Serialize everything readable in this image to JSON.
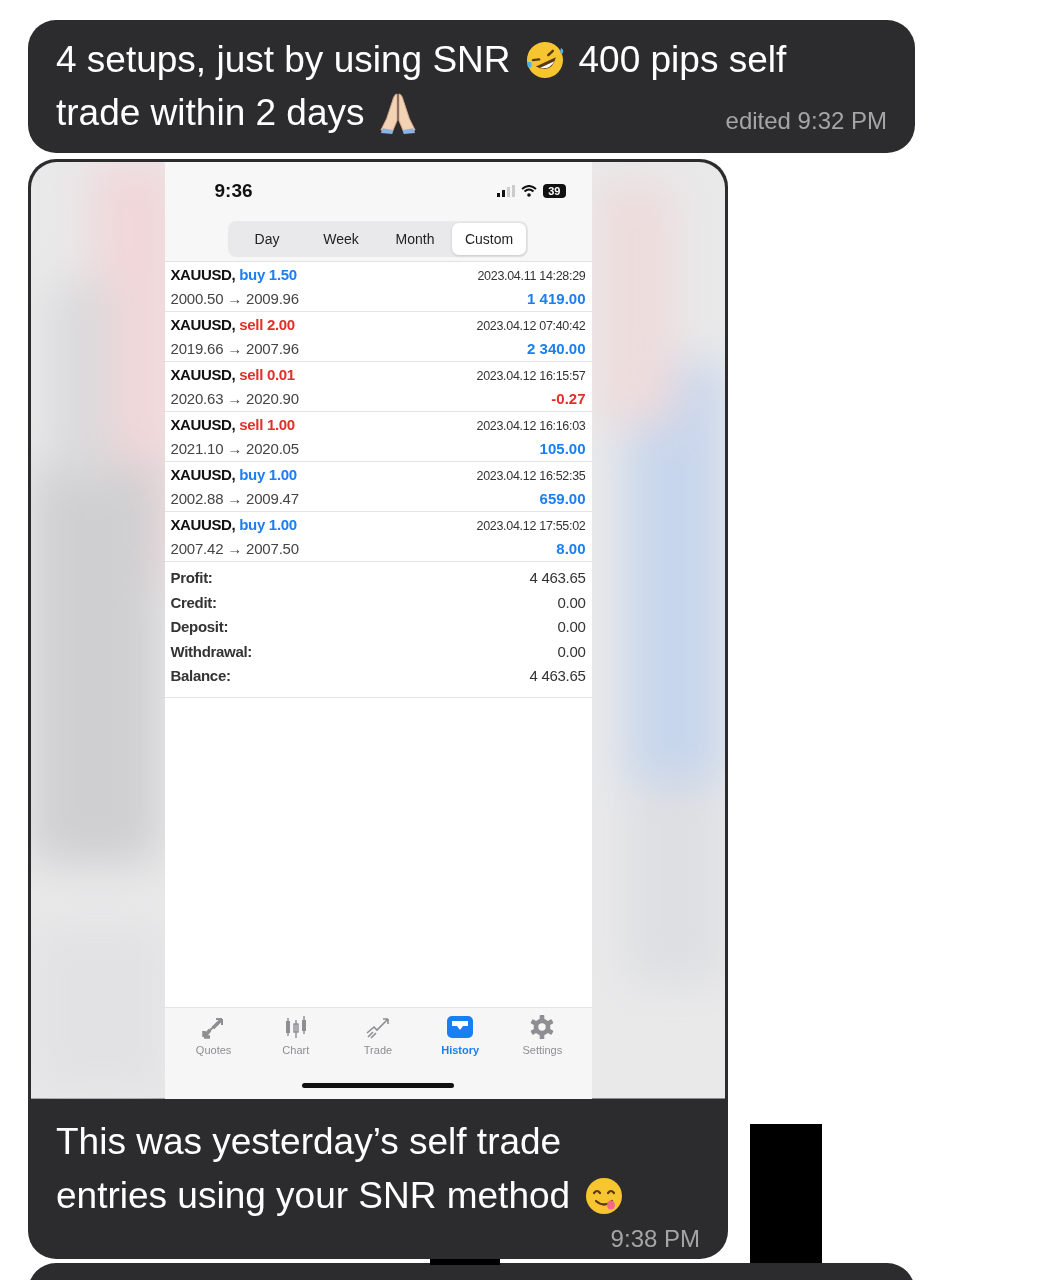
{
  "messages": [
    {
      "kind": "text",
      "lines": [
        [
          {
            "kind": "text",
            "text": "4 setups, just by using SNR"
          },
          {
            "kind": "laughing-emoji"
          },
          {
            "kind": "text",
            "text": "400 pips self"
          }
        ],
        [
          {
            "kind": "text",
            "text": "trade within 2 days"
          },
          {
            "kind": "praying-emoji"
          }
        ]
      ],
      "time": "edited 9:32 PM"
    },
    {
      "kind": "screenshot",
      "caption_lines": [
        [
          {
            "kind": "text",
            "text": "This was yesterday’s self trade"
          }
        ],
        [
          {
            "kind": "text",
            "text": "entries using your SNR method"
          },
          {
            "kind": "yum-emoji"
          }
        ]
      ],
      "time": "9:38 PM",
      "phone": {
        "status_time": "9:36",
        "battery": "39",
        "tabs": [
          {
            "label": "Day",
            "selected": false
          },
          {
            "label": "Week",
            "selected": false
          },
          {
            "label": "Month",
            "selected": false
          },
          {
            "label": "Custom",
            "selected": true
          }
        ],
        "trades": [
          {
            "symbol": "XAUUSD,",
            "kind": "buy",
            "order": "buy 1.50",
            "time": "2023.04.11 14:28:29",
            "prices": "2000.50 → 2009.96",
            "profit": "1 419.00",
            "negative": false
          },
          {
            "symbol": "XAUUSD,",
            "kind": "sell",
            "order": "sell 2.00",
            "time": "2023.04.12 07:40:42",
            "prices": "2019.66 → 2007.96",
            "profit": "2 340.00",
            "negative": false
          },
          {
            "symbol": "XAUUSD,",
            "kind": "sell",
            "order": "sell 0.01",
            "time": "2023.04.12 16:15:57",
            "prices": "2020.63 → 2020.90",
            "profit": "-0.27",
            "negative": true
          },
          {
            "symbol": "XAUUSD,",
            "kind": "sell",
            "order": "sell 1.00",
            "time": "2023.04.12 16:16:03",
            "prices": "2021.10 → 2020.05",
            "profit": "105.00",
            "negative": false
          },
          {
            "symbol": "XAUUSD,",
            "kind": "buy",
            "order": "buy 1.00",
            "time": "2023.04.12 16:52:35",
            "prices": "2002.88 → 2009.47",
            "profit": "659.00",
            "negative": false
          },
          {
            "symbol": "XAUUSD,",
            "kind": "buy",
            "order": "buy 1.00",
            "time": "2023.04.12 17:55:02",
            "prices": "2007.42 → 2007.50",
            "profit": "8.00",
            "negative": false
          }
        ],
        "summary": [
          {
            "label": "Profit:",
            "value": "4 463.65"
          },
          {
            "label": "Credit:",
            "value": "0.00"
          },
          {
            "label": "Deposit:",
            "value": "0.00"
          },
          {
            "label": "Withdrawal:",
            "value": "0.00"
          },
          {
            "label": "Balance:",
            "value": "4 463.65"
          }
        ],
        "nav": [
          {
            "kind": "quotes",
            "label": "Quotes",
            "selected": false
          },
          {
            "kind": "chart",
            "label": "Chart",
            "selected": false
          },
          {
            "kind": "trade",
            "label": "Trade",
            "selected": false
          },
          {
            "kind": "history",
            "label": "History",
            "selected": true
          },
          {
            "kind": "settings",
            "label": "Settings",
            "selected": false
          }
        ]
      }
    }
  ]
}
